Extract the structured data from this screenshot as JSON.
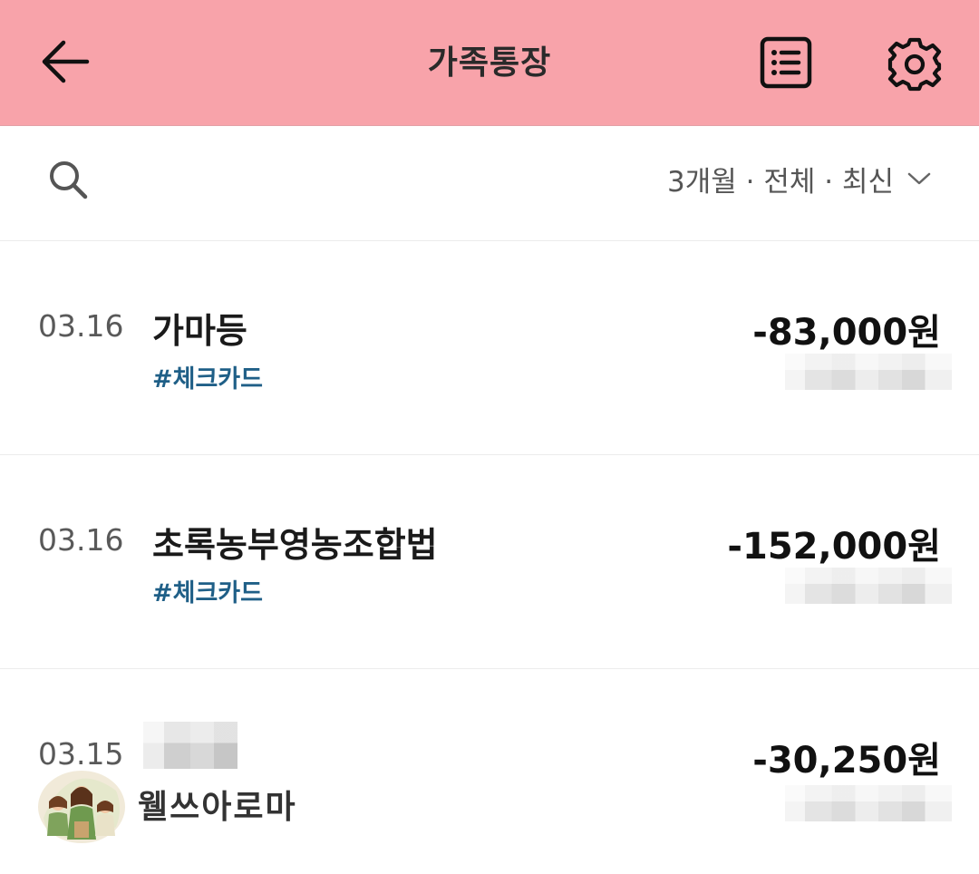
{
  "header": {
    "title": "가족통장",
    "background_color": "#f8a3aa",
    "back_icon": "arrow-left-icon",
    "list_icon": "list-icon",
    "settings_icon": "gear-icon"
  },
  "filter": {
    "search_icon": "search-icon",
    "label": "3개월 · 전체 · 최신",
    "chevron_icon": "chevron-down-icon"
  },
  "transactions": [
    {
      "date": "03.16",
      "name": "가마등",
      "tag": "#체크카드",
      "amount": "-83,000원"
    },
    {
      "date": "03.16",
      "name": "초록농부영농조합법",
      "tag": "#체크카드",
      "amount": "-152,000원"
    },
    {
      "date": "03.15",
      "name": "",
      "tag": "",
      "amount": "-30,250원"
    }
  ],
  "watermark": {
    "text": "웰쓰아로마"
  },
  "colors": {
    "tag": "#1f5f87",
    "header": "#f8a3aa"
  }
}
